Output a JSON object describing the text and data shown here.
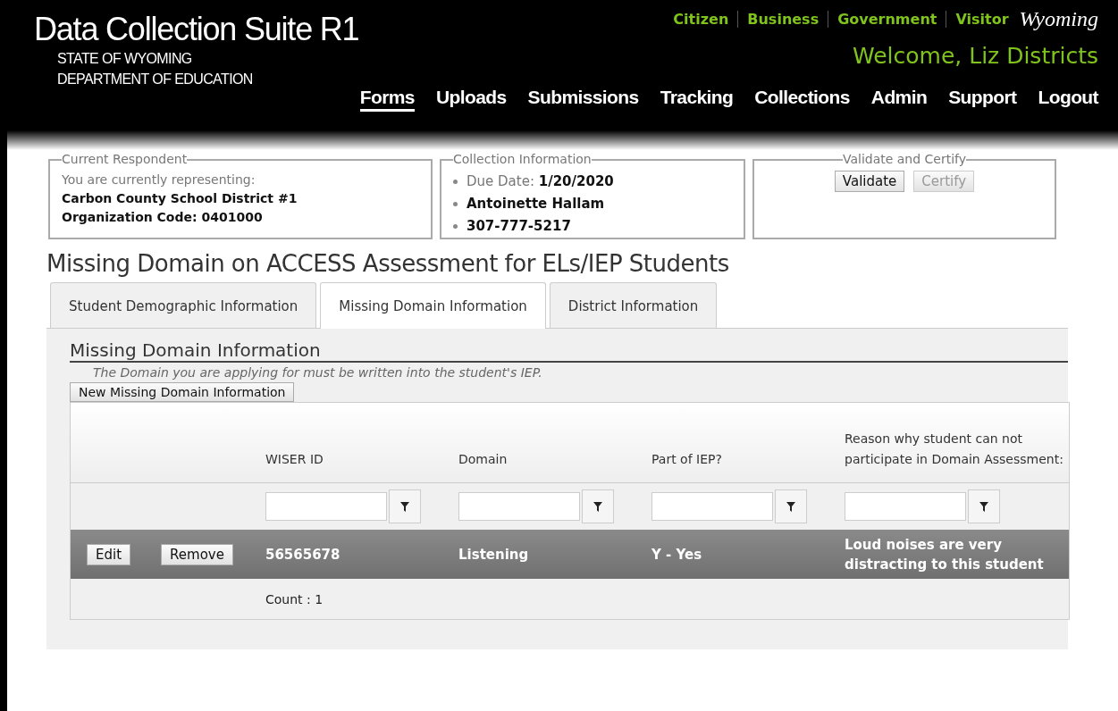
{
  "header": {
    "title": "Data Collection Suite R1",
    "subtitle_lines": [
      "STATE OF WYOMING",
      "DEPARTMENT OF EDUCATION"
    ],
    "audience_links": [
      {
        "label": "Citizen"
      },
      {
        "label": "Business"
      },
      {
        "label": "Government"
      },
      {
        "label": "Visitor"
      }
    ],
    "logo_text": "Wyoming",
    "welcome": "Welcome, Liz Districts"
  },
  "nav": [
    {
      "label": "Forms",
      "selected": true
    },
    {
      "label": "Uploads",
      "selected": false
    },
    {
      "label": "Submissions",
      "selected": false
    },
    {
      "label": "Tracking",
      "selected": false
    },
    {
      "label": "Collections",
      "selected": false
    },
    {
      "label": "Admin",
      "selected": false
    },
    {
      "label": "Support",
      "selected": false
    },
    {
      "label": "Logout",
      "selected": false
    }
  ],
  "respondent": {
    "legend": "Current Respondent",
    "intro": "You are currently representing:",
    "lines": [
      "Carbon County School District #1",
      "Organization Code: 0401000"
    ]
  },
  "collection": {
    "legend": "Collection Information",
    "items": [
      {
        "label": "Due Date:",
        "value": "1/20/2020"
      },
      {
        "value": "Antoinette Hallam"
      },
      {
        "value": "307-777-5217"
      }
    ]
  },
  "certify": {
    "legend": "Validate and Certify",
    "buttons": [
      {
        "label": "Validate",
        "disabled": false
      },
      {
        "label": "Certify",
        "disabled": true
      }
    ]
  },
  "page_title": "Missing Domain on ACCESS Assessment for ELs/IEP Students",
  "tabs": [
    {
      "label": "Student Demographic Information",
      "selected": false
    },
    {
      "label": "Missing Domain Information",
      "selected": true
    },
    {
      "label": "District Information",
      "selected": false
    }
  ],
  "section": {
    "title": "Missing Domain Information",
    "note": "The Domain you are applying for must be written into the student's IEP.",
    "new_button": "New Missing Domain Information"
  },
  "table": {
    "columns": [
      {
        "label": "WISER ID"
      },
      {
        "label": "Domain"
      },
      {
        "label": "Part of IEP?"
      },
      {
        "label": "Reason why student can not participate in Domain Assessment:"
      }
    ],
    "rows": [
      {
        "actions": [
          "Edit",
          "Remove"
        ],
        "cells": [
          "56565678",
          "Listening",
          "Y - Yes",
          "Loud noises are very distracting to this student"
        ]
      }
    ],
    "count": "Count : 1"
  }
}
